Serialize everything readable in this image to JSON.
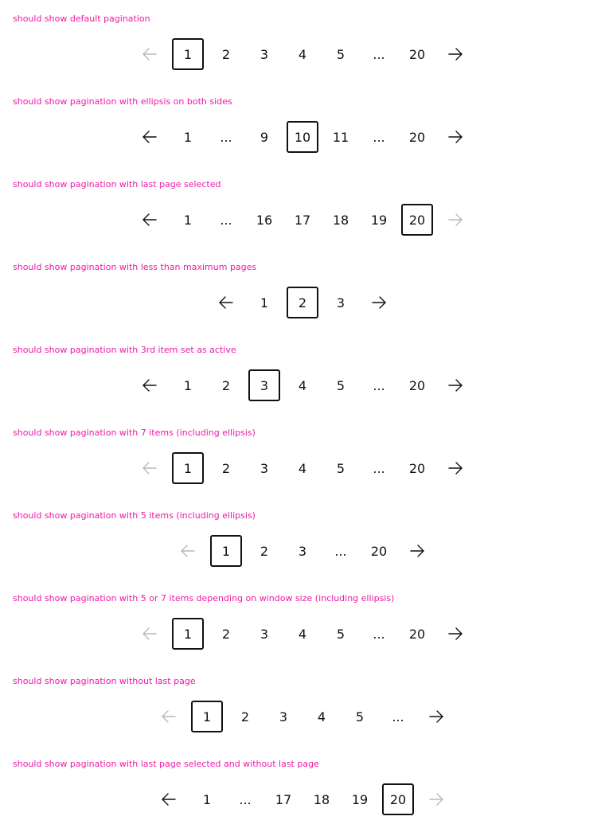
{
  "icons": {
    "prev": "arrow-left-icon",
    "next": "arrow-right-icon"
  },
  "colors": {
    "caption": "#ee1aa8",
    "text": "#111111",
    "disabled": "#b8b8b8"
  },
  "examples": [
    {
      "caption": "should show default pagination",
      "prev_disabled": true,
      "next_disabled": false,
      "items": [
        {
          "label": "1",
          "type": "page",
          "active": true
        },
        {
          "label": "2",
          "type": "page"
        },
        {
          "label": "3",
          "type": "page"
        },
        {
          "label": "4",
          "type": "page"
        },
        {
          "label": "5",
          "type": "page"
        },
        {
          "label": "...",
          "type": "ellipsis"
        },
        {
          "label": "20",
          "type": "page"
        }
      ]
    },
    {
      "caption": "should show pagination with ellipsis on both sides",
      "prev_disabled": false,
      "next_disabled": false,
      "items": [
        {
          "label": "1",
          "type": "page"
        },
        {
          "label": "...",
          "type": "ellipsis"
        },
        {
          "label": "9",
          "type": "page"
        },
        {
          "label": "10",
          "type": "page",
          "active": true
        },
        {
          "label": "11",
          "type": "page"
        },
        {
          "label": "...",
          "type": "ellipsis"
        },
        {
          "label": "20",
          "type": "page"
        }
      ]
    },
    {
      "caption": "should show pagination with last page selected",
      "prev_disabled": false,
      "next_disabled": true,
      "items": [
        {
          "label": "1",
          "type": "page"
        },
        {
          "label": "...",
          "type": "ellipsis"
        },
        {
          "label": "16",
          "type": "page"
        },
        {
          "label": "17",
          "type": "page"
        },
        {
          "label": "18",
          "type": "page"
        },
        {
          "label": "19",
          "type": "page"
        },
        {
          "label": "20",
          "type": "page",
          "active": true
        }
      ]
    },
    {
      "caption": "should show pagination with less than maximum pages",
      "prev_disabled": false,
      "next_disabled": false,
      "items": [
        {
          "label": "1",
          "type": "page"
        },
        {
          "label": "2",
          "type": "page",
          "active": true
        },
        {
          "label": "3",
          "type": "page"
        }
      ]
    },
    {
      "caption": "should show pagination with 3rd item set as active",
      "prev_disabled": false,
      "next_disabled": false,
      "items": [
        {
          "label": "1",
          "type": "page"
        },
        {
          "label": "2",
          "type": "page"
        },
        {
          "label": "3",
          "type": "page",
          "active": true
        },
        {
          "label": "4",
          "type": "page"
        },
        {
          "label": "5",
          "type": "page"
        },
        {
          "label": "...",
          "type": "ellipsis"
        },
        {
          "label": "20",
          "type": "page"
        }
      ]
    },
    {
      "caption": "should show pagination with 7 items (including ellipsis)",
      "prev_disabled": true,
      "next_disabled": false,
      "items": [
        {
          "label": "1",
          "type": "page",
          "active": true
        },
        {
          "label": "2",
          "type": "page"
        },
        {
          "label": "3",
          "type": "page"
        },
        {
          "label": "4",
          "type": "page"
        },
        {
          "label": "5",
          "type": "page"
        },
        {
          "label": "...",
          "type": "ellipsis"
        },
        {
          "label": "20",
          "type": "page"
        }
      ]
    },
    {
      "caption": "should show pagination with 5 items (including ellipsis)",
      "prev_disabled": true,
      "next_disabled": false,
      "items": [
        {
          "label": "1",
          "type": "page",
          "active": true
        },
        {
          "label": "2",
          "type": "page"
        },
        {
          "label": "3",
          "type": "page"
        },
        {
          "label": "...",
          "type": "ellipsis"
        },
        {
          "label": "20",
          "type": "page"
        }
      ]
    },
    {
      "caption": "should show pagination with 5 or 7 items depending on window size (including ellipsis)",
      "prev_disabled": true,
      "next_disabled": false,
      "items": [
        {
          "label": "1",
          "type": "page",
          "active": true
        },
        {
          "label": "2",
          "type": "page"
        },
        {
          "label": "3",
          "type": "page"
        },
        {
          "label": "4",
          "type": "page"
        },
        {
          "label": "5",
          "type": "page"
        },
        {
          "label": "...",
          "type": "ellipsis"
        },
        {
          "label": "20",
          "type": "page"
        }
      ]
    },
    {
      "caption": "should show pagination without last page",
      "prev_disabled": true,
      "next_disabled": false,
      "items": [
        {
          "label": "1",
          "type": "page",
          "active": true
        },
        {
          "label": "2",
          "type": "page"
        },
        {
          "label": "3",
          "type": "page"
        },
        {
          "label": "4",
          "type": "page"
        },
        {
          "label": "5",
          "type": "page"
        },
        {
          "label": "...",
          "type": "ellipsis"
        }
      ]
    },
    {
      "caption": "should show pagination with last page selected and without last page",
      "prev_disabled": false,
      "next_disabled": true,
      "items": [
        {
          "label": "1",
          "type": "page"
        },
        {
          "label": "...",
          "type": "ellipsis"
        },
        {
          "label": "17",
          "type": "page"
        },
        {
          "label": "18",
          "type": "page"
        },
        {
          "label": "19",
          "type": "page"
        },
        {
          "label": "20",
          "type": "page",
          "active": true
        }
      ]
    }
  ]
}
